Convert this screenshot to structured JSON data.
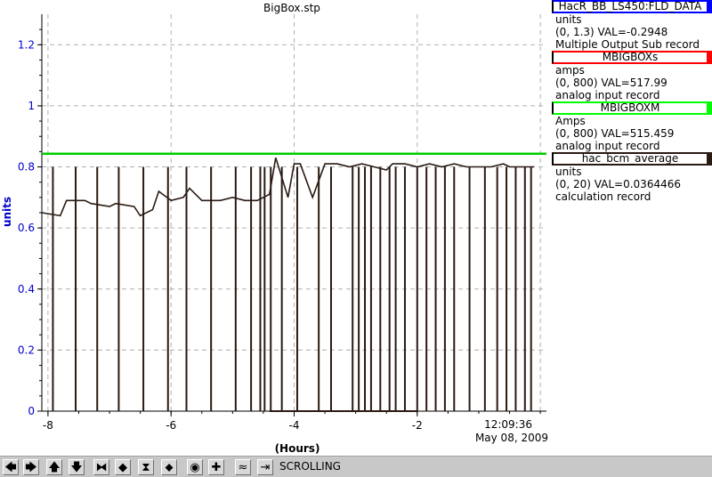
{
  "window": {
    "title": "BigBox.stp"
  },
  "plot": {
    "y_ticks": [
      "0",
      "0.2",
      "0.4",
      "0.6",
      "0.8",
      "1",
      "1.2"
    ],
    "x_ticks": [
      "-8",
      "-6",
      "-4",
      "-2"
    ],
    "y_unit_label": "units",
    "x_unit_label": "(Hours)",
    "time_label": "12:09:36",
    "date_label": "May 08, 2009"
  },
  "chart_data": {
    "type": "line",
    "title": "BigBox.stp",
    "xlabel": "(Hours)",
    "ylabel": "units",
    "xlim": [
      -8.1,
      0.1
    ],
    "ylim": [
      0,
      1.3
    ],
    "grid": true,
    "series": [
      {
        "name": "MBIGBOXM",
        "color": "#00cc00",
        "x": [
          -8.1,
          0.1
        ],
        "y": [
          0.843,
          0.843
        ]
      },
      {
        "name": "hac_bcm_average",
        "color": "#2a1a12",
        "x": [
          -8.1,
          -7.8,
          -7.7,
          -7.4,
          -7.3,
          -7.0,
          -6.9,
          -6.6,
          -6.5,
          -6.3,
          -6.2,
          -6.0,
          -5.8,
          -5.7,
          -5.5,
          -5.2,
          -5.0,
          -4.8,
          -4.6,
          -4.4,
          -4.3,
          -4.1,
          -4.0,
          -3.9,
          -3.7,
          -3.5,
          -3.3,
          -3.1,
          -2.9,
          -2.7,
          -2.5,
          -2.4,
          -2.2,
          -2.0,
          -1.8,
          -1.6,
          -1.4,
          -1.2,
          -1.0,
          -0.8,
          -0.6,
          -0.5,
          -0.3,
          -0.1
        ],
        "y": [
          0.65,
          0.64,
          0.69,
          0.69,
          0.68,
          0.67,
          0.68,
          0.67,
          0.64,
          0.66,
          0.72,
          0.69,
          0.7,
          0.73,
          0.69,
          0.69,
          0.7,
          0.69,
          0.69,
          0.71,
          0.83,
          0.7,
          0.81,
          0.81,
          0.7,
          0.81,
          0.81,
          0.8,
          0.81,
          0.8,
          0.79,
          0.81,
          0.81,
          0.8,
          0.81,
          0.8,
          0.81,
          0.8,
          0.8,
          0.8,
          0.81,
          0.8,
          0.8,
          0.8
        ]
      }
    ]
  },
  "legend": [
    {
      "name": "HacR_BB_LS450:FLD_DATA",
      "color": "#0000ff",
      "unit": "units",
      "range_val": "(0, 1.3) VAL=-0.2948",
      "record": "Multiple Output Sub record"
    },
    {
      "name": "MBIGBOXs",
      "color": "#ff0000",
      "unit": "amps",
      "range_val": "(0, 800) VAL=517.99",
      "record": "analog input record"
    },
    {
      "name": "MBIGBOXM",
      "color": "#00ff00",
      "unit": "Amps",
      "range_val": "(0, 800) VAL=515.459",
      "record": "analog input record"
    },
    {
      "name": "hac_bcm_average",
      "color": "#2a1a12",
      "unit": "units",
      "range_val": "(0, 20) VAL=0.0364466",
      "record": "calculation record"
    }
  ],
  "toolbar": {
    "status": "SCROLLING",
    "buttons": [
      {
        "name": "scroll-left-button",
        "glyph": "🡄"
      },
      {
        "name": "scroll-right-button",
        "glyph": "🡆"
      },
      {
        "name": "scroll-up-button",
        "glyph": "🡅"
      },
      {
        "name": "scroll-down-button",
        "glyph": "🡇"
      },
      {
        "name": "zoom-in-horizontal-button",
        "glyph": "⧓"
      },
      {
        "name": "zoom-out-horizontal-button",
        "glyph": "◆"
      },
      {
        "name": "zoom-in-vertical-button",
        "glyph": "⧗"
      },
      {
        "name": "zoom-out-vertical-button",
        "glyph": "⬥"
      },
      {
        "name": "autoscale-button",
        "glyph": "◉"
      },
      {
        "name": "add-pv-button",
        "glyph": "✚"
      },
      {
        "name": "waveform-button",
        "glyph": "≈"
      },
      {
        "name": "scroll-mode-button",
        "glyph": "⇥"
      }
    ]
  }
}
